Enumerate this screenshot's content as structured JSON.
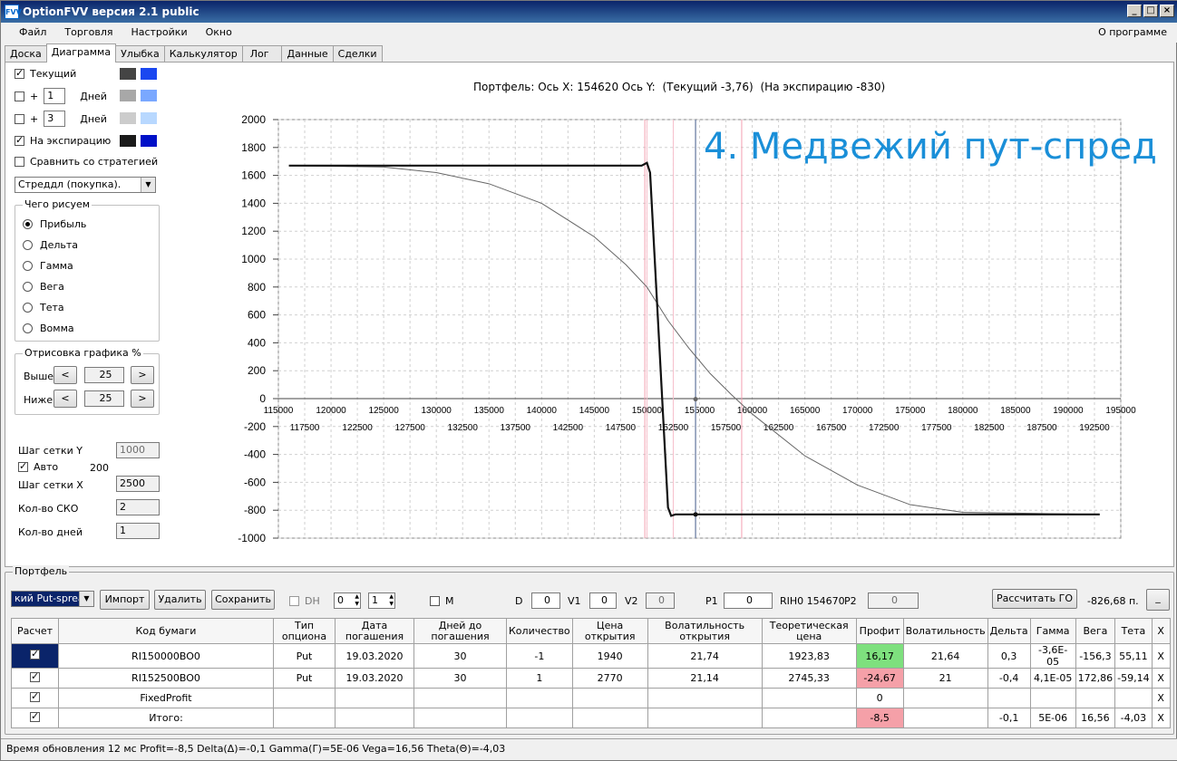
{
  "app": {
    "title": "OptionFVV версия 2.1 public",
    "icon": "fvv-app-icon"
  },
  "menu": {
    "items": [
      "Файл",
      "Торговля",
      "Настройки",
      "Окно"
    ],
    "about": "О программе"
  },
  "tabs": [
    "Доска",
    "Диаграмма",
    "Улыбка",
    "Калькулятор",
    "Лог",
    "Данные",
    "Сделки"
  ],
  "left": {
    "current": {
      "label": "Текущий",
      "checked": true,
      "color1": "#444444",
      "color2": "#1a47f0"
    },
    "plus1": {
      "plus": "+",
      "value": "1",
      "unit": "Дней",
      "checked": false,
      "color1": "#a8a8a8",
      "color2": "#7aa8ff"
    },
    "plus3": {
      "plus": "+",
      "value": "3",
      "unit": "Дней",
      "checked": false,
      "color1": "#cccccc",
      "color2": "#b8d8ff"
    },
    "expiry": {
      "label": "На экспирацию",
      "checked": true,
      "color1": "#1a1a1a",
      "color2": "#0010c8"
    },
    "compare": {
      "label": "Сравнить со стратегией",
      "checked": false
    },
    "strategy": "Стреддл (покупка).",
    "what": {
      "title": "Чего рисуем",
      "options": [
        "Прибыль",
        "Дельта",
        "Гамма",
        "Вега",
        "Тета",
        "Вомма"
      ],
      "selected": 0
    },
    "draw": {
      "title": "Отрисовка графика %",
      "above_label": "Выше",
      "above_value": "25",
      "below_label": "Ниже",
      "below_value": "25",
      "prev": "<",
      "next": ">"
    },
    "grid_y_label": "Шаг сетки Y",
    "grid_y_value": "1000",
    "auto_label": "Авто",
    "auto_value": "200",
    "auto_checked": true,
    "grid_x_label": "Шаг сетки X",
    "grid_x_value": "2500",
    "sko_label": "Кол-во СКО",
    "sko_value": "2",
    "days_label": "Кол-во дней",
    "days_value": "1"
  },
  "chart_header": {
    "portfolio_label": "Портфель:",
    "x_axis_label": "Ось X:",
    "x_value": "154620",
    "y_axis_label": "Ось Y:",
    "current_text": "(Текущий -3,76)",
    "expiry_text": "(На экспирацию -830)"
  },
  "chart_data": {
    "type": "line",
    "title": "4. Медвежий пут-спред",
    "xlim": [
      115000,
      195000
    ],
    "ylim": [
      -1000,
      2000
    ],
    "x_ticks_top": [
      "115000",
      "120000",
      "125000",
      "130000",
      "135000",
      "140000",
      "145000",
      "150000",
      "155000",
      "160000",
      "165000",
      "170000",
      "175000",
      "180000",
      "185000",
      "190000",
      "195000"
    ],
    "x_ticks_bottom": [
      "117500",
      "122500",
      "127500",
      "132500",
      "137500",
      "142500",
      "147500",
      "152500",
      "157500",
      "162500",
      "167500",
      "172500",
      "177500",
      "182500",
      "187500",
      "192500"
    ],
    "y_ticks": [
      "2000",
      "1800",
      "1600",
      "1400",
      "1200",
      "1000",
      "800",
      "600",
      "400",
      "200",
      "0",
      "-200",
      "-400",
      "-600",
      "-800",
      "-1000"
    ],
    "grid": true,
    "current_price": 154620,
    "strikes": [
      150000,
      152500
    ],
    "std_lines": [
      149800,
      159000
    ],
    "series": [
      {
        "color": "#666666",
        "x": [
          116000,
          125000,
          130000,
          135000,
          140000,
          145000,
          148000,
          150000,
          152000,
          154000,
          156000,
          158000,
          160000,
          165000,
          170000,
          175000,
          180000,
          193000
        ],
        "y": [
          1670,
          1660,
          1620,
          1540,
          1400,
          1160,
          960,
          800,
          560,
          360,
          180,
          30,
          -110,
          -410,
          -620,
          -760,
          -815,
          -830
        ]
      },
      {
        "color": "#111111",
        "x": [
          116000,
          149500,
          150000,
          150300,
          152000,
          152300,
          152700,
          154620,
          193000
        ],
        "y": [
          1670,
          1670,
          1690,
          1620,
          -780,
          -840,
          -830,
          -830,
          -830
        ]
      }
    ]
  },
  "portfolio": {
    "title": "Портфель",
    "combo": "кий Put-spread",
    "import": "Импорт",
    "delete": "Удалить",
    "save": "Сохранить",
    "dh": "DH",
    "spin1": "0",
    "spin2": "1",
    "m": "M",
    "d_label": "D",
    "d_value": "0",
    "v1_label": "V1",
    "v1_value": "0",
    "v2_label": "V2",
    "v2_value": "0",
    "p1_label": "P1",
    "p1_value": "0",
    "base": "RIH0 154670",
    "p2_label": "P2",
    "p2_value": "0",
    "calc_go": "Рассчитать ГО",
    "go_value": "-826,68 п.",
    "dash": "_",
    "columns": [
      "Расчет",
      "Код бумаги",
      "Тип опциона",
      "Дата погашения",
      "Дней до погашения",
      "Количество",
      "Цена открытия",
      "Волатильность открытия",
      "Теоретическая цена",
      "Профит",
      "Волатильность",
      "Дельта",
      "Гамма",
      "Вега",
      "Тета",
      "X"
    ],
    "rows": [
      {
        "check": true,
        "code": "RI150000BO0",
        "type": "Put",
        "date": "19.03.2020",
        "days": "30",
        "qty": "-1",
        "price": "1940",
        "vol_open": "21,74",
        "theo": "1923,83",
        "profit": "16,17",
        "vol": "21,64",
        "delta": "0,3",
        "gamma": "-3,6E-05",
        "vega": "-156,3",
        "theta": "55,11",
        "x": "X"
      },
      {
        "check": true,
        "code": "RI152500BO0",
        "type": "Put",
        "date": "19.03.2020",
        "days": "30",
        "qty": "1",
        "price": "2770",
        "vol_open": "21,14",
        "theo": "2745,33",
        "profit": "-24,67",
        "vol": "21",
        "delta": "-0,4",
        "gamma": "4,1E-05",
        "vega": "172,86",
        "theta": "-59,14",
        "x": "X"
      },
      {
        "check": true,
        "code": "FixedProfit",
        "type": "",
        "date": "",
        "days": "",
        "qty": "",
        "price": "",
        "vol_open": "",
        "theo": "",
        "profit": "0",
        "vol": "",
        "delta": "",
        "gamma": "",
        "vega": "",
        "theta": "",
        "x": "X"
      },
      {
        "check": true,
        "code": "Итого:",
        "type": "",
        "date": "",
        "days": "",
        "qty": "",
        "price": "",
        "vol_open": "",
        "theo": "",
        "profit": "-8,5",
        "vol": "",
        "delta": "-0,1",
        "gamma": "5E-06",
        "vega": "16,56",
        "theta": "-4,03",
        "x": "X"
      }
    ],
    "profit_colors": {
      "positive": "#7ee07e",
      "negative": "#f5a0a8",
      "neutral": "#ffffff"
    }
  },
  "status": "Время обновления 12 мс  Profit=-8,5 Delta(Δ)=-0,1 Gamma(Γ)=5E-06 Vega=16,56 Theta(Θ)=-4,03"
}
